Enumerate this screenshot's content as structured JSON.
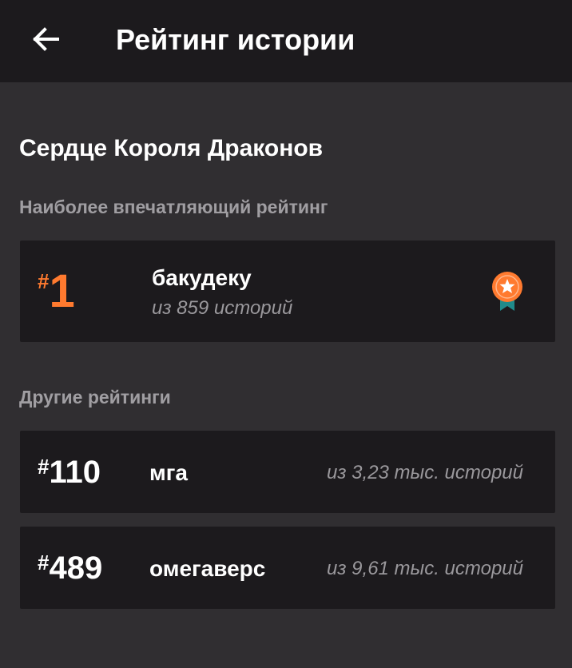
{
  "appbar": {
    "title": "Рейтинг истории",
    "back_icon": "arrow-left-icon"
  },
  "story": {
    "title": "Сердце Короля Драконов"
  },
  "top_section": {
    "label": "Наиболее впечатляющий рейтинг",
    "item": {
      "hash": "#",
      "rank": "1",
      "tag": "бакудеку",
      "count": "из 859 историй",
      "badge_icon": "ribbon-star-icon"
    }
  },
  "other_section": {
    "label": "Другие рейтинги",
    "items": [
      {
        "hash": "#",
        "rank": "110",
        "tag": "мга",
        "count": "из 3,23 тыс. историй"
      },
      {
        "hash": "#",
        "rank": "489",
        "tag": "омегаверс",
        "count": "из 9,61 тыс. историй"
      }
    ]
  },
  "colors": {
    "accent": "#ff7a2f",
    "background": "#302e31",
    "card": "#1c1a1d",
    "muted_text": "#a09ea2",
    "badge_ribbon": "#1f8a8a"
  }
}
